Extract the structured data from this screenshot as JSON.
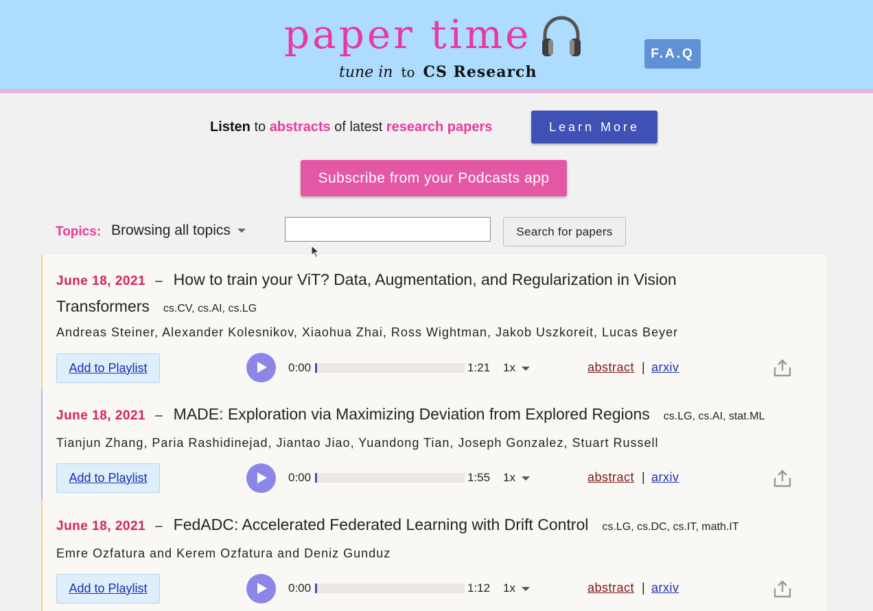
{
  "header": {
    "title": "paper time",
    "tagline_tune": "tune in",
    "tagline_to": "to",
    "tagline_subject": "CS Research",
    "faq_label": "F.A.Q"
  },
  "intro": {
    "listen": "Listen",
    "to": "to",
    "abstracts": "abstracts",
    "of_latest": "of latest",
    "research_papers": "research papers",
    "learn_more_label": "Learn More",
    "subscribe_label": "Subscribe from your Podcasts app"
  },
  "filter": {
    "topics_label": "Topics:",
    "topics_value": "Browsing all topics",
    "search_value": "",
    "search_button_label": "Search for papers"
  },
  "colors": {
    "accent_pink": "#e8399e",
    "header_bg": "#addcff",
    "learn_more_bg": "#3f51b5",
    "date_red": "#d6225b"
  },
  "papers": [
    {
      "date": "June 18, 2021",
      "dash": "–",
      "title": "How to train your ViT? Data, Augmentation, and Regularization in Vision Transformers",
      "tags": "cs.CV, cs.AI, cs.LG",
      "authors": "Andreas Steiner, Alexander Kolesnikov, Xiaohua Zhai, Ross Wightman, Jakob Uszkoreit, Lucas Beyer",
      "playlist_label": "Add to Playlist",
      "current_time": "0:00",
      "duration": "1:21",
      "progress": 0,
      "speed": "1x",
      "abstract_label": "abstract",
      "separator": "|",
      "arxiv_label": "arxiv"
    },
    {
      "date": "June 18, 2021",
      "dash": "–",
      "title": "MADE: Exploration via Maximizing Deviation from Explored Regions",
      "tags": "cs.LG, cs.AI, stat.ML",
      "authors": "Tianjun Zhang, Paria Rashidinejad, Jiantao Jiao, Yuandong Tian, Joseph Gonzalez, Stuart Russell",
      "playlist_label": "Add to Playlist",
      "current_time": "0:00",
      "duration": "1:55",
      "progress": 0,
      "speed": "1x",
      "abstract_label": "abstract",
      "separator": "|",
      "arxiv_label": "arxiv"
    },
    {
      "date": "June 18, 2021",
      "dash": "–",
      "title": "FedADC: Accelerated Federated Learning with Drift Control",
      "tags": "cs.LG, cs.DC, cs.IT, math.IT",
      "authors": "Emre Ozfatura and Kerem Ozfatura and Deniz Gunduz",
      "playlist_label": "Add to Playlist",
      "current_time": "0:00",
      "duration": "1:12",
      "progress": 0,
      "speed": "1x",
      "abstract_label": "abstract",
      "separator": "|",
      "arxiv_label": "arxiv"
    }
  ]
}
